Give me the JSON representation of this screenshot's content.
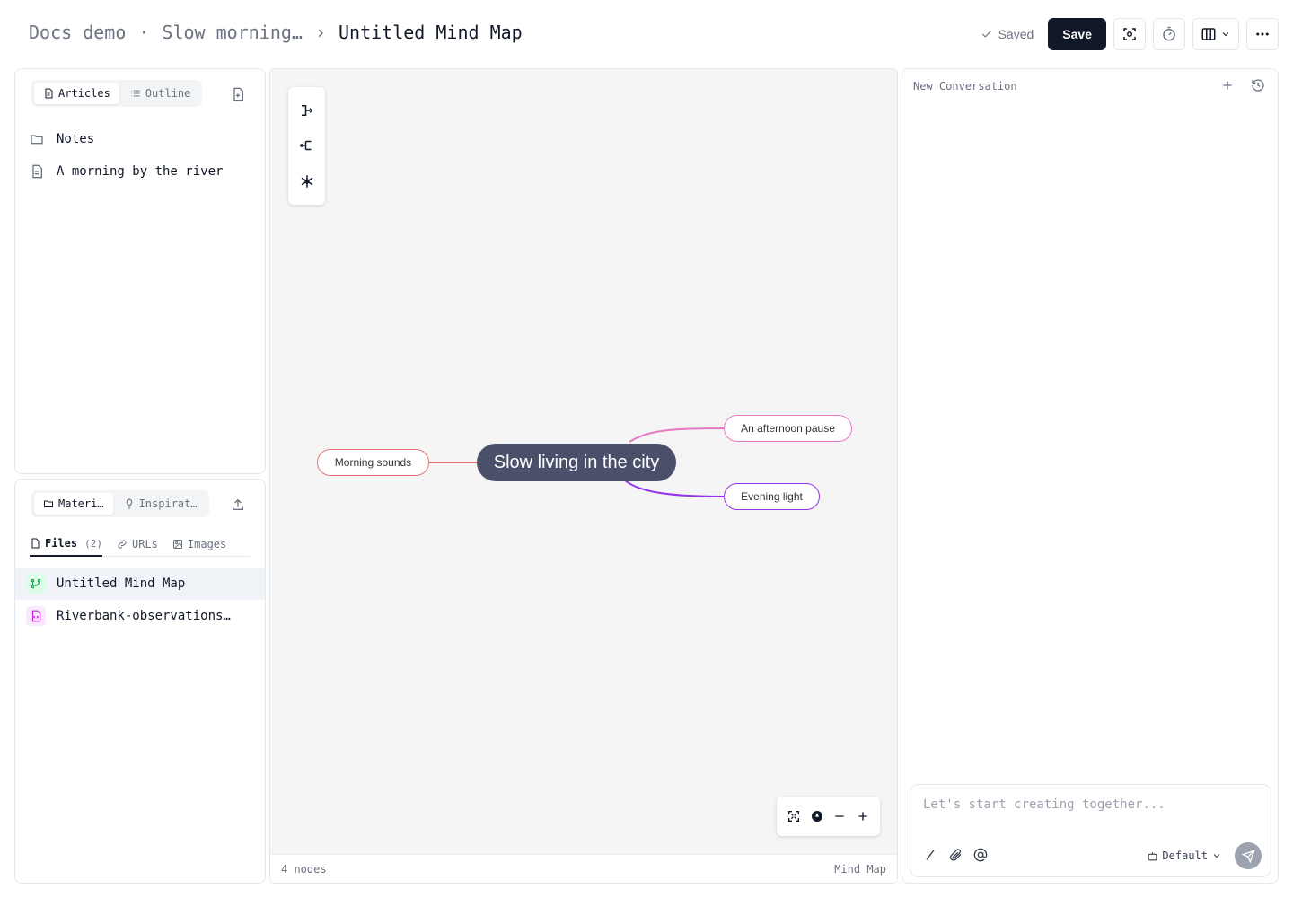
{
  "header": {
    "breadcrumb": [
      "Docs demo",
      "Slow morning…",
      "Untitled Mind Map"
    ],
    "dot": "·",
    "chevron": "›",
    "saved_label": "Saved",
    "save_label": "Save"
  },
  "articles_panel": {
    "tabs": [
      "Articles",
      "Outline"
    ],
    "items": [
      {
        "label": "Notes",
        "icon": "folder-icon"
      },
      {
        "label": "A morning by the river",
        "icon": "file-text-icon"
      }
    ]
  },
  "materials_panel": {
    "tabs": [
      "Materi…",
      "Inspirat…"
    ],
    "subtabs": [
      {
        "label": "Files",
        "count": "(2)"
      },
      {
        "label": "URLs"
      },
      {
        "label": "Images"
      }
    ],
    "files": [
      {
        "label": "Untitled Mind Map",
        "icon": "git-branch-icon",
        "color": "#16a34a"
      },
      {
        "label": "Riverbank-observations…",
        "icon": "code-file-icon",
        "color": "#c026d3"
      }
    ]
  },
  "canvas": {
    "root": "Slow living in the city",
    "children": [
      {
        "label": "Morning sounds",
        "color": "#e57373"
      },
      {
        "label": "An afternoon pause",
        "color": "#e879c8"
      },
      {
        "label": "Evening light",
        "color": "#9333ea"
      }
    ],
    "status_left": "4 nodes",
    "status_right": "Mind Map"
  },
  "chat": {
    "title": "New Conversation",
    "placeholder": "Let's start creating together...",
    "model": "Default"
  }
}
